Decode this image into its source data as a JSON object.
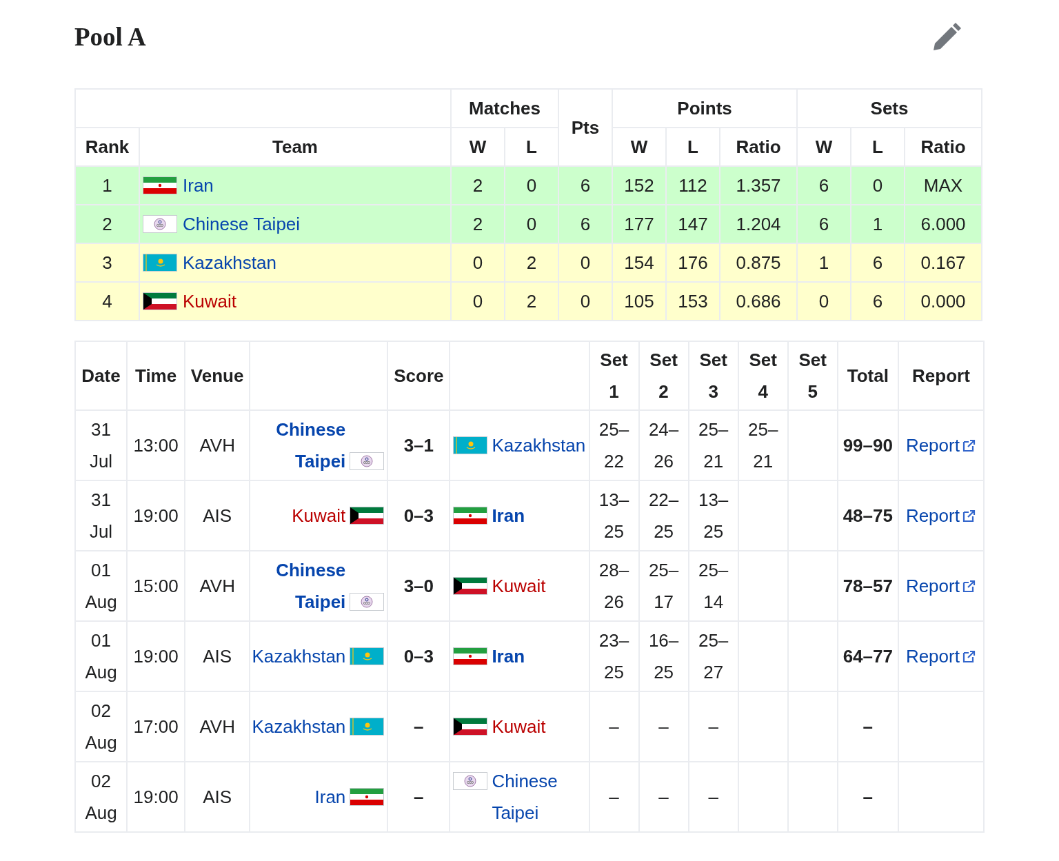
{
  "title": "Pool A",
  "standings": {
    "group_headers": [
      "Matches",
      "Pts",
      "Points",
      "Sets"
    ],
    "columns": [
      "Rank",
      "Team",
      "W",
      "L",
      "W",
      "L",
      "Ratio",
      "W",
      "L",
      "Ratio"
    ],
    "rows": [
      {
        "rank": "1",
        "team": "Iran",
        "flag": {
          "kind": "iran"
        },
        "link_missing": false,
        "color": "#ccffcc",
        "values": [
          "2",
          "0",
          "6",
          "152",
          "112",
          "1.357",
          "6",
          "0",
          "MAX"
        ]
      },
      {
        "rank": "2",
        "team": "Chinese Taipei",
        "flag": {
          "kind": "taipei"
        },
        "link_missing": false,
        "color": "#ccffcc",
        "values": [
          "2",
          "0",
          "6",
          "177",
          "147",
          "1.204",
          "6",
          "1",
          "6.000"
        ]
      },
      {
        "rank": "3",
        "team": "Kazakhstan",
        "flag": {
          "kind": "kazakhstan"
        },
        "link_missing": false,
        "color": "#ffffcc",
        "values": [
          "0",
          "2",
          "0",
          "154",
          "176",
          "0.875",
          "1",
          "6",
          "0.167"
        ]
      },
      {
        "rank": "4",
        "team": "Kuwait",
        "flag": {
          "kind": "kuwait"
        },
        "link_missing": true,
        "color": "#ffffcc",
        "values": [
          "0",
          "2",
          "0",
          "105",
          "153",
          "0.686",
          "0",
          "6",
          "0.000"
        ]
      }
    ]
  },
  "matches": {
    "columns": [
      "Date",
      "Time",
      "Venue",
      "Score",
      "Set 1",
      "Set 2",
      "Set 3",
      "Set 4",
      "Set 5",
      "Total",
      "Report"
    ],
    "rows": [
      {
        "date": "31 Jul",
        "time": "13:00",
        "venue": "AVH",
        "home": {
          "name": "Chinese Taipei",
          "flag": {
            "kind": "taipei"
          },
          "winner": true,
          "link_missing": false
        },
        "score": "3–1",
        "away": {
          "name": "Kazakhstan",
          "flag": {
            "kind": "kazakhstan"
          },
          "winner": false,
          "link_missing": false
        },
        "sets": [
          "25–22",
          "24–26",
          "25–21",
          "25–21"
        ],
        "total": "99–90",
        "report": "Report"
      },
      {
        "date": "31 Jul",
        "time": "19:00",
        "venue": "AIS",
        "home": {
          "name": "Kuwait",
          "flag": {
            "kind": "kuwait"
          },
          "winner": false,
          "link_missing": true
        },
        "score": "0–3",
        "away": {
          "name": "Iran",
          "flag": {
            "kind": "iran"
          },
          "winner": true,
          "link_missing": false
        },
        "sets": [
          "13–25",
          "22–25",
          "13–25"
        ],
        "total": "48–75",
        "report": "Report"
      },
      {
        "date": "01 Aug",
        "time": "15:00",
        "venue": "AVH",
        "home": {
          "name": "Chinese Taipei",
          "flag": {
            "kind": "taipei"
          },
          "winner": true,
          "link_missing": false
        },
        "score": "3–0",
        "away": {
          "name": "Kuwait",
          "flag": {
            "kind": "kuwait"
          },
          "winner": false,
          "link_missing": true
        },
        "sets": [
          "28–26",
          "25–17",
          "25–14"
        ],
        "total": "78–57",
        "report": "Report"
      },
      {
        "date": "01 Aug",
        "time": "19:00",
        "venue": "AIS",
        "home": {
          "name": "Kazakhstan",
          "flag": {
            "kind": "kazakhstan"
          },
          "winner": false,
          "link_missing": false
        },
        "score": "0–3",
        "away": {
          "name": "Iran",
          "flag": {
            "kind": "iran"
          },
          "winner": true,
          "link_missing": false
        },
        "sets": [
          "23–25",
          "16–25",
          "25–27"
        ],
        "total": "64–77",
        "report": "Report"
      },
      {
        "date": "02 Aug",
        "time": "17:00",
        "venue": "AVH",
        "home": {
          "name": "Kazakhstan",
          "flag": {
            "kind": "kazakhstan"
          },
          "winner": false,
          "link_missing": false
        },
        "score": "–",
        "away": {
          "name": "Kuwait",
          "flag": {
            "kind": "kuwait"
          },
          "winner": false,
          "link_missing": true
        },
        "sets": [
          "–",
          "–",
          "–"
        ],
        "total": "–"
      },
      {
        "date": "02 Aug",
        "time": "19:00",
        "venue": "AIS",
        "home": {
          "name": "Iran",
          "flag": {
            "kind": "iran"
          },
          "winner": false,
          "link_missing": false
        },
        "score": "–",
        "away": {
          "name": "Chinese Taipei",
          "flag": {
            "kind": "taipei"
          },
          "winner": false,
          "link_missing": false
        },
        "sets": [
          "–",
          "–",
          "–"
        ],
        "total": "–"
      }
    ]
  }
}
